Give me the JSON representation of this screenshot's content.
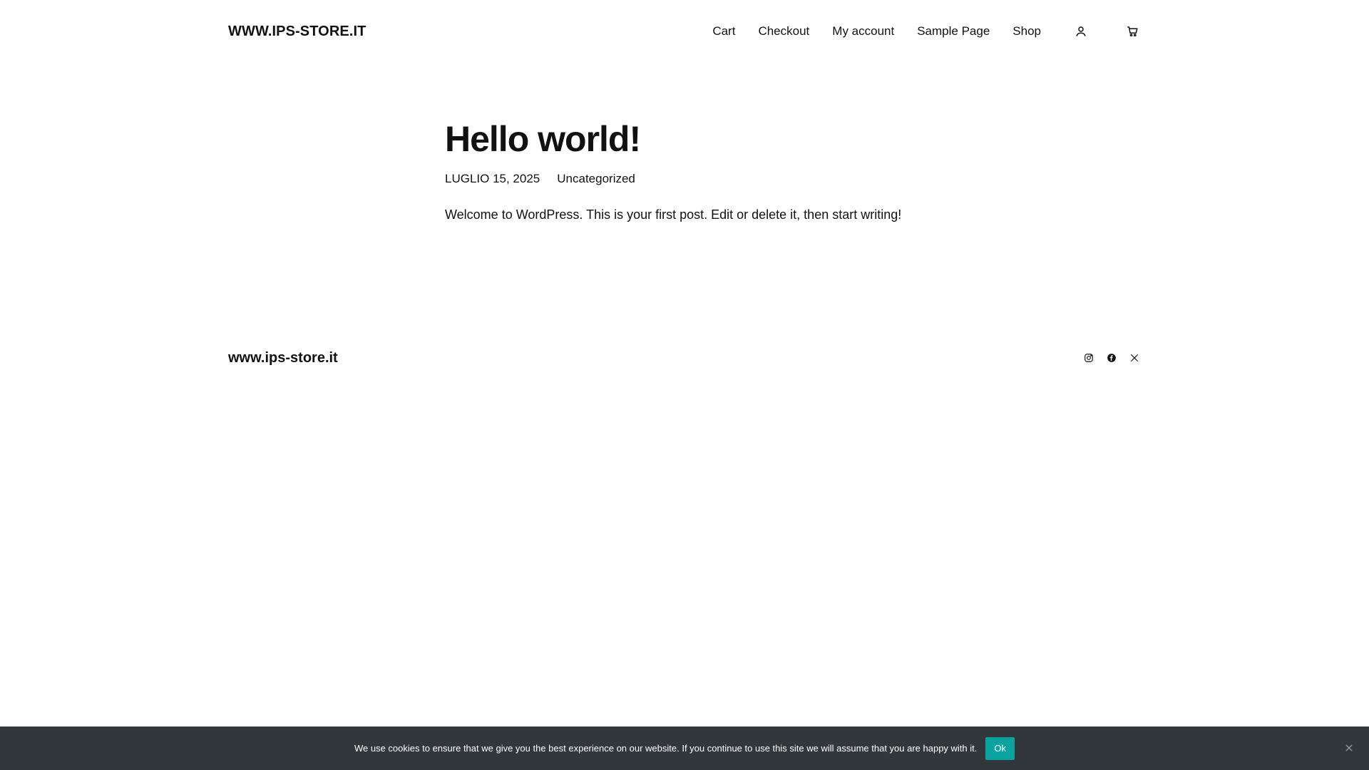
{
  "header": {
    "site_title": "WWW.IPS-STORE.IT",
    "nav": [
      {
        "label": "Cart"
      },
      {
        "label": "Checkout"
      },
      {
        "label": "My account"
      },
      {
        "label": "Sample Page"
      },
      {
        "label": "Shop"
      }
    ],
    "icons": {
      "account": "user-icon",
      "cart": "cart-icon"
    }
  },
  "post": {
    "title": "Hello world!",
    "date": "LUGLIO 15, 2025",
    "category": "Uncategorized",
    "content": "Welcome to WordPress. This is your first post. Edit or delete it, then start writing!"
  },
  "footer": {
    "title": "www.ips-store.it",
    "social": [
      "instagram-icon",
      "facebook-icon",
      "x-icon"
    ]
  },
  "cookie_notice": {
    "text": "We use cookies to ensure that we give you the best experience on our website. If you continue to use this site we will assume that you are happy with it.",
    "ok_label": "Ok",
    "accent_color": "#0aa3a0",
    "background_color": "#32373c"
  }
}
